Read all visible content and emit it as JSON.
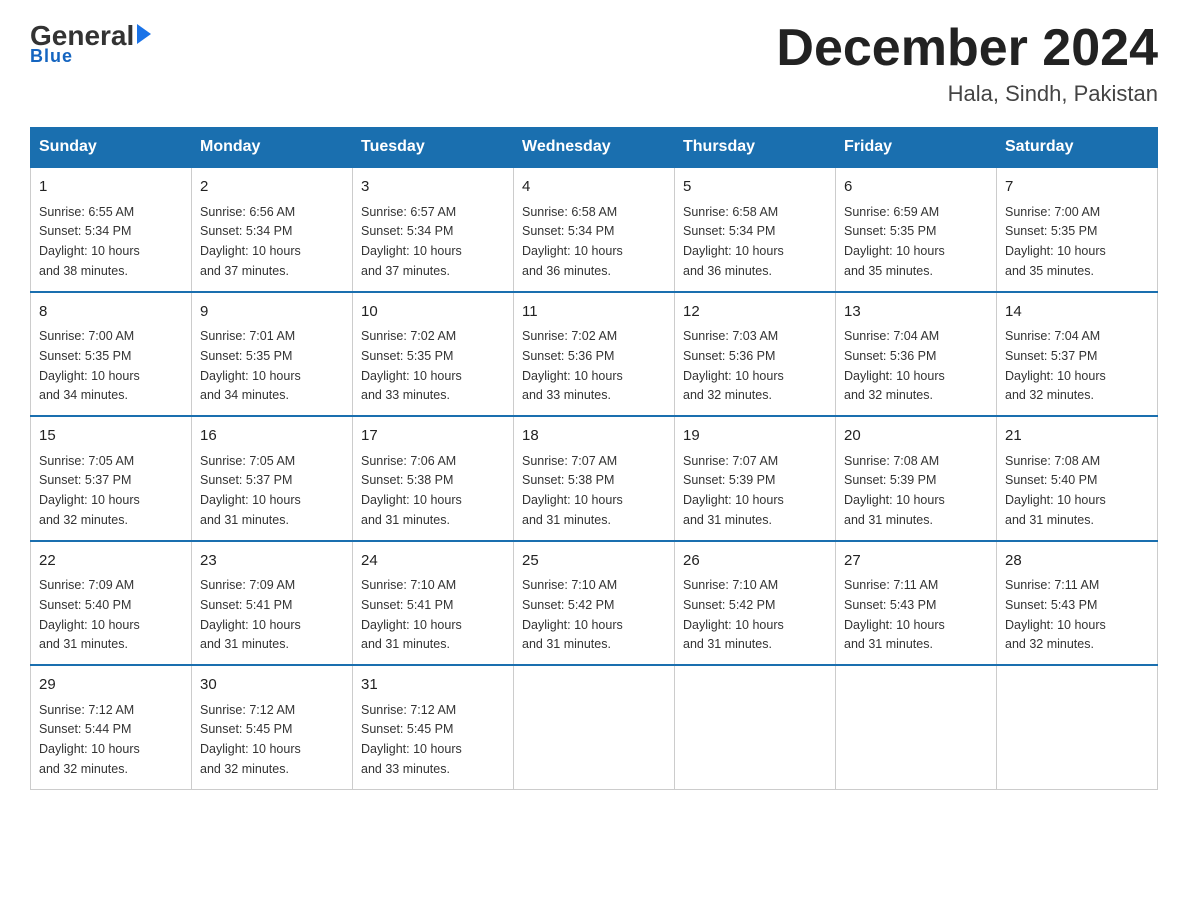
{
  "header": {
    "logo_general": "General",
    "logo_blue": "Blue",
    "month_title": "December 2024",
    "location": "Hala, Sindh, Pakistan"
  },
  "days_of_week": [
    "Sunday",
    "Monday",
    "Tuesday",
    "Wednesday",
    "Thursday",
    "Friday",
    "Saturday"
  ],
  "weeks": [
    [
      {
        "day": "1",
        "sunrise": "6:55 AM",
        "sunset": "5:34 PM",
        "daylight": "10 hours and 38 minutes."
      },
      {
        "day": "2",
        "sunrise": "6:56 AM",
        "sunset": "5:34 PM",
        "daylight": "10 hours and 37 minutes."
      },
      {
        "day": "3",
        "sunrise": "6:57 AM",
        "sunset": "5:34 PM",
        "daylight": "10 hours and 37 minutes."
      },
      {
        "day": "4",
        "sunrise": "6:58 AM",
        "sunset": "5:34 PM",
        "daylight": "10 hours and 36 minutes."
      },
      {
        "day": "5",
        "sunrise": "6:58 AM",
        "sunset": "5:34 PM",
        "daylight": "10 hours and 36 minutes."
      },
      {
        "day": "6",
        "sunrise": "6:59 AM",
        "sunset": "5:35 PM",
        "daylight": "10 hours and 35 minutes."
      },
      {
        "day": "7",
        "sunrise": "7:00 AM",
        "sunset": "5:35 PM",
        "daylight": "10 hours and 35 minutes."
      }
    ],
    [
      {
        "day": "8",
        "sunrise": "7:00 AM",
        "sunset": "5:35 PM",
        "daylight": "10 hours and 34 minutes."
      },
      {
        "day": "9",
        "sunrise": "7:01 AM",
        "sunset": "5:35 PM",
        "daylight": "10 hours and 34 minutes."
      },
      {
        "day": "10",
        "sunrise": "7:02 AM",
        "sunset": "5:35 PM",
        "daylight": "10 hours and 33 minutes."
      },
      {
        "day": "11",
        "sunrise": "7:02 AM",
        "sunset": "5:36 PM",
        "daylight": "10 hours and 33 minutes."
      },
      {
        "day": "12",
        "sunrise": "7:03 AM",
        "sunset": "5:36 PM",
        "daylight": "10 hours and 32 minutes."
      },
      {
        "day": "13",
        "sunrise": "7:04 AM",
        "sunset": "5:36 PM",
        "daylight": "10 hours and 32 minutes."
      },
      {
        "day": "14",
        "sunrise": "7:04 AM",
        "sunset": "5:37 PM",
        "daylight": "10 hours and 32 minutes."
      }
    ],
    [
      {
        "day": "15",
        "sunrise": "7:05 AM",
        "sunset": "5:37 PM",
        "daylight": "10 hours and 32 minutes."
      },
      {
        "day": "16",
        "sunrise": "7:05 AM",
        "sunset": "5:37 PM",
        "daylight": "10 hours and 31 minutes."
      },
      {
        "day": "17",
        "sunrise": "7:06 AM",
        "sunset": "5:38 PM",
        "daylight": "10 hours and 31 minutes."
      },
      {
        "day": "18",
        "sunrise": "7:07 AM",
        "sunset": "5:38 PM",
        "daylight": "10 hours and 31 minutes."
      },
      {
        "day": "19",
        "sunrise": "7:07 AM",
        "sunset": "5:39 PM",
        "daylight": "10 hours and 31 minutes."
      },
      {
        "day": "20",
        "sunrise": "7:08 AM",
        "sunset": "5:39 PM",
        "daylight": "10 hours and 31 minutes."
      },
      {
        "day": "21",
        "sunrise": "7:08 AM",
        "sunset": "5:40 PM",
        "daylight": "10 hours and 31 minutes."
      }
    ],
    [
      {
        "day": "22",
        "sunrise": "7:09 AM",
        "sunset": "5:40 PM",
        "daylight": "10 hours and 31 minutes."
      },
      {
        "day": "23",
        "sunrise": "7:09 AM",
        "sunset": "5:41 PM",
        "daylight": "10 hours and 31 minutes."
      },
      {
        "day": "24",
        "sunrise": "7:10 AM",
        "sunset": "5:41 PM",
        "daylight": "10 hours and 31 minutes."
      },
      {
        "day": "25",
        "sunrise": "7:10 AM",
        "sunset": "5:42 PM",
        "daylight": "10 hours and 31 minutes."
      },
      {
        "day": "26",
        "sunrise": "7:10 AM",
        "sunset": "5:42 PM",
        "daylight": "10 hours and 31 minutes."
      },
      {
        "day": "27",
        "sunrise": "7:11 AM",
        "sunset": "5:43 PM",
        "daylight": "10 hours and 31 minutes."
      },
      {
        "day": "28",
        "sunrise": "7:11 AM",
        "sunset": "5:43 PM",
        "daylight": "10 hours and 32 minutes."
      }
    ],
    [
      {
        "day": "29",
        "sunrise": "7:12 AM",
        "sunset": "5:44 PM",
        "daylight": "10 hours and 32 minutes."
      },
      {
        "day": "30",
        "sunrise": "7:12 AM",
        "sunset": "5:45 PM",
        "daylight": "10 hours and 32 minutes."
      },
      {
        "day": "31",
        "sunrise": "7:12 AM",
        "sunset": "5:45 PM",
        "daylight": "10 hours and 33 minutes."
      },
      null,
      null,
      null,
      null
    ]
  ],
  "labels": {
    "sunrise": "Sunrise:",
    "sunset": "Sunset:",
    "daylight": "Daylight:"
  }
}
